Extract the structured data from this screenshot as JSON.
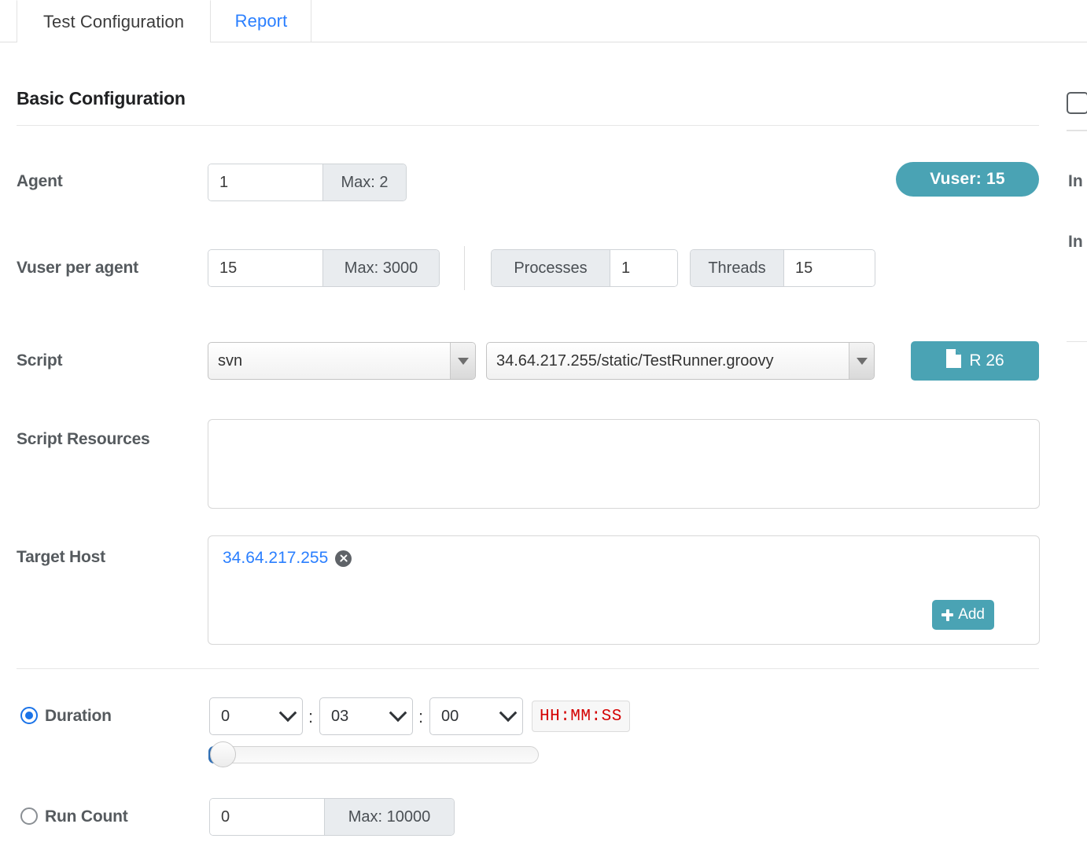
{
  "tabs": [
    {
      "label": "Test Configuration",
      "active": true
    },
    {
      "label": "Report",
      "active": false
    }
  ],
  "section": {
    "title": "Basic Configuration"
  },
  "agent": {
    "label": "Agent",
    "value": "1",
    "max_label": "Max: 2"
  },
  "vuser_badge": {
    "label": "Vuser: 15"
  },
  "vuser_per_agent": {
    "label": "Vuser per agent",
    "value": "15",
    "max_label": "Max: 3000",
    "processes_label": "Processes",
    "processes_value": "1",
    "threads_label": "Threads",
    "threads_value": "15"
  },
  "script": {
    "label": "Script",
    "scm_value": "svn",
    "path_value": "34.64.217.255/static/TestRunner.groovy",
    "revision_button": "R 26",
    "revision_icon": "file-icon"
  },
  "script_resources": {
    "label": "Script Resources",
    "value": ""
  },
  "target_host": {
    "label": "Target Host",
    "hosts": [
      {
        "name": "34.64.217.255",
        "remove_icon": "remove-circle-icon"
      }
    ],
    "add_label": "Add",
    "add_icon": "plus-icon"
  },
  "duration": {
    "label": "Duration",
    "selected": true,
    "hours": "0",
    "minutes": "03",
    "seconds": "00",
    "separator": ":",
    "format_hint": "HH:MM:SS",
    "slider_percent": 2
  },
  "run_count": {
    "label": "Run Count",
    "selected": false,
    "value": "0",
    "max_label": "Max: 10000"
  },
  "right_panel": {
    "checkbox_checked": false,
    "labels": [
      "In",
      "In"
    ]
  },
  "colors": {
    "accent_teal": "#4aa3b4",
    "link_blue": "#2a7fff",
    "radio_blue": "#1a73e8",
    "error_red": "#d40000",
    "addon_gray": "#e9ecef"
  }
}
